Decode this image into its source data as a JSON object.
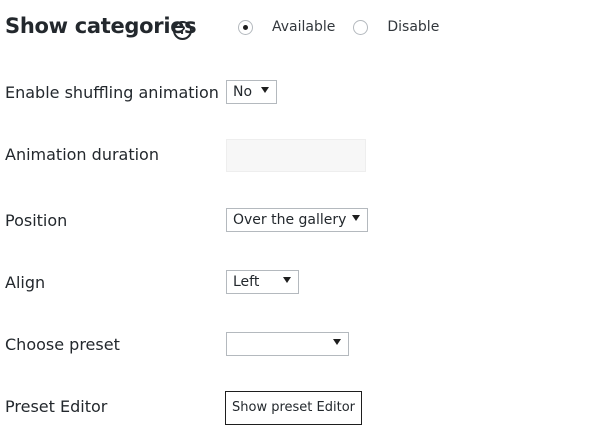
{
  "header": {
    "title": "Show categories",
    "help_glyph": "?",
    "options": [
      {
        "label": "Available",
        "checked": true
      },
      {
        "label": "Disable",
        "checked": false
      }
    ]
  },
  "fields": {
    "shuffle": {
      "label": "Enable shuffling animation",
      "value": "No"
    },
    "duration": {
      "label": "Animation duration",
      "value": ""
    },
    "position": {
      "label": "Position",
      "value": "Over the gallery"
    },
    "align": {
      "label": "Align",
      "value": "Left"
    },
    "preset": {
      "label": "Choose preset",
      "value": ""
    },
    "editor": {
      "label": "Preset Editor",
      "button_label": "Show preset Editor"
    }
  },
  "icons": {
    "help": "question-circle-icon",
    "dropdown": "chevron-down-icon"
  }
}
